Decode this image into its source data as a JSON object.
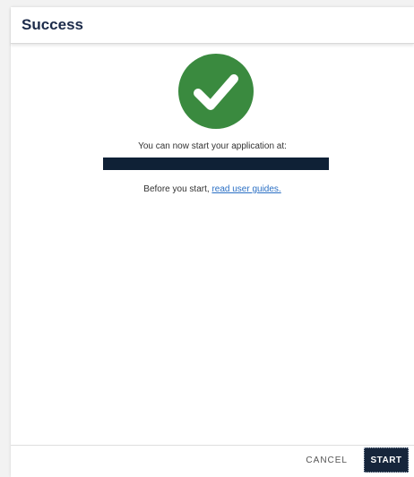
{
  "dialog": {
    "title": "Success",
    "message": "You can now start your application at:",
    "guides_prefix": "Before you start, ",
    "guides_link": "read user guides."
  },
  "footer": {
    "cancel_label": "CANCEL",
    "start_label": "START"
  },
  "icons": {
    "success": "checkmark-circle-icon"
  },
  "colors": {
    "success_green": "#3a8a3f",
    "title_navy": "#1c2b4a",
    "start_button": "#16253b",
    "link_blue": "#2a6fc4"
  }
}
